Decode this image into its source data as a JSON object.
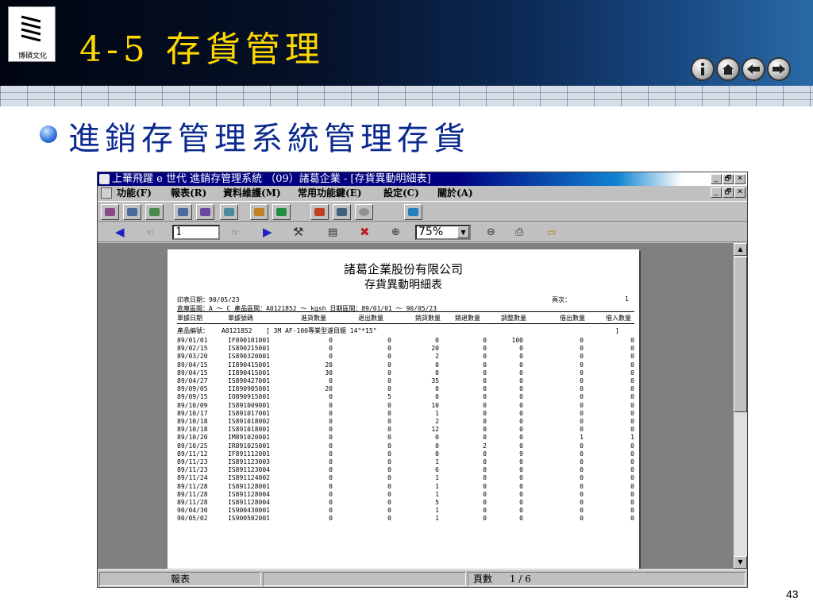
{
  "slide": {
    "logo_text": "博碩文化",
    "title": "4-5 存貨管理",
    "bullet": "進銷存管理系統管理存貨",
    "page_number": "43"
  },
  "window": {
    "title": "上華飛躍 e 世代 進銷存管理系統 （09）諸葛企業 - [存貨異動明細表]",
    "ctrl": {
      "min": "_",
      "max": "🗗",
      "close": "✕"
    },
    "menu": [
      "功能(F)",
      "報表(R)",
      "資料維護(M)",
      "常用功能鍵(E)",
      "設定(C)",
      "關於(A)"
    ],
    "page_input": "1",
    "zoom": "75%"
  },
  "report": {
    "company": "諸葛企業股份有限公司",
    "title": "存貨異動明細表",
    "print_date": "印表日期：90/05/23",
    "page_label": "頁次：",
    "page_value": "1",
    "range_line": "倉庫區間：A ～ C 產品區間：A0121852 ～ kgsh 日期區間：89/01/01 ～ 90/05/23",
    "headers": [
      "單據日期",
      "單據號碼",
      "進貨數量",
      "退出數量",
      "銷貨數量",
      "銷退數量",
      "調整數量",
      "借出數量",
      "借入數量"
    ],
    "product_label": "產品編號：",
    "product_code": "A0121852",
    "product_desc": "[ 3M AF-100專業型濾目鏡 14\"*15\"",
    "product_end": "]",
    "rows": [
      [
        "89/01/01",
        "IF890101001",
        "0",
        "0",
        "0",
        "0",
        "100",
        "0",
        "0"
      ],
      [
        "89/02/15",
        "IS890215001",
        "0",
        "0",
        "20",
        "0",
        "0",
        "0",
        "0"
      ],
      [
        "89/03/20",
        "IS890320001",
        "0",
        "0",
        "2",
        "0",
        "0",
        "0",
        "0"
      ],
      [
        "89/04/15",
        "II890415001",
        "20",
        "0",
        "0",
        "0",
        "0",
        "0",
        "0"
      ],
      [
        "89/04/15",
        "II890415001",
        "30",
        "0",
        "0",
        "0",
        "0",
        "0",
        "0"
      ],
      [
        "89/04/27",
        "IS890427001",
        "0",
        "0",
        "35",
        "0",
        "0",
        "0",
        "0"
      ],
      [
        "89/09/05",
        "II890905001",
        "20",
        "0",
        "0",
        "0",
        "0",
        "0",
        "0"
      ],
      [
        "89/09/15",
        "IO890915001",
        "0",
        "5",
        "0",
        "0",
        "0",
        "0",
        "0"
      ],
      [
        "89/10/09",
        "IS891009001",
        "0",
        "0",
        "10",
        "0",
        "0",
        "0",
        "0"
      ],
      [
        "89/10/17",
        "IS891017001",
        "0",
        "0",
        "1",
        "0",
        "0",
        "0",
        "0"
      ],
      [
        "89/10/18",
        "IS891018002",
        "0",
        "0",
        "2",
        "0",
        "0",
        "0",
        "0"
      ],
      [
        "89/10/18",
        "IS891018001",
        "0",
        "0",
        "12",
        "0",
        "0",
        "0",
        "0"
      ],
      [
        "89/10/20",
        "IM891020001",
        "0",
        "0",
        "0",
        "0",
        "0",
        "1",
        "1"
      ],
      [
        "89/10/25",
        "IR891025001",
        "0",
        "0",
        "0",
        "2",
        "0",
        "0",
        "0"
      ],
      [
        "89/11/12",
        "IF891112001",
        "0",
        "0",
        "0",
        "0",
        "9",
        "0",
        "0"
      ],
      [
        "89/11/23",
        "IS891123003",
        "0",
        "0",
        "1",
        "0",
        "0",
        "0",
        "0"
      ],
      [
        "89/11/23",
        "IS891123004",
        "0",
        "0",
        "6",
        "0",
        "0",
        "0",
        "0"
      ],
      [
        "89/11/24",
        "IS891124002",
        "0",
        "0",
        "1",
        "0",
        "0",
        "0",
        "0"
      ],
      [
        "89/11/28",
        "IS891128001",
        "0",
        "0",
        "1",
        "0",
        "0",
        "0",
        "0"
      ],
      [
        "89/11/28",
        "IS891128004",
        "0",
        "0",
        "1",
        "0",
        "0",
        "0",
        "0"
      ],
      [
        "89/11/28",
        "IS891128004",
        "0",
        "0",
        "5",
        "0",
        "0",
        "0",
        "0"
      ],
      [
        "90/04/30",
        "IS900430001",
        "0",
        "0",
        "1",
        "0",
        "0",
        "0",
        "0"
      ],
      [
        "90/05/02",
        "IS900502001",
        "0",
        "0",
        "1",
        "0",
        "0",
        "0",
        "0"
      ]
    ]
  },
  "status": {
    "left": "報表",
    "page_label": "頁數",
    "page_value": "1 / 6"
  },
  "icons": {
    "toolbar1": [
      "print-icon",
      "print-icon",
      "print-icon",
      "print-icon",
      "print-icon",
      "print-icon",
      "report-icon",
      "chart-icon",
      "edit-icon",
      "text-icon",
      "clock-icon",
      "export-icon"
    ],
    "toolbar2": [
      "first-page-icon",
      "prev-page-icon",
      "next-page-icon",
      "last-page-icon",
      "tools-icon",
      "document-icon",
      "close-report-icon",
      "zoom-in-icon",
      "zoom-out-icon",
      "printer-icon",
      "folder-icon"
    ]
  }
}
